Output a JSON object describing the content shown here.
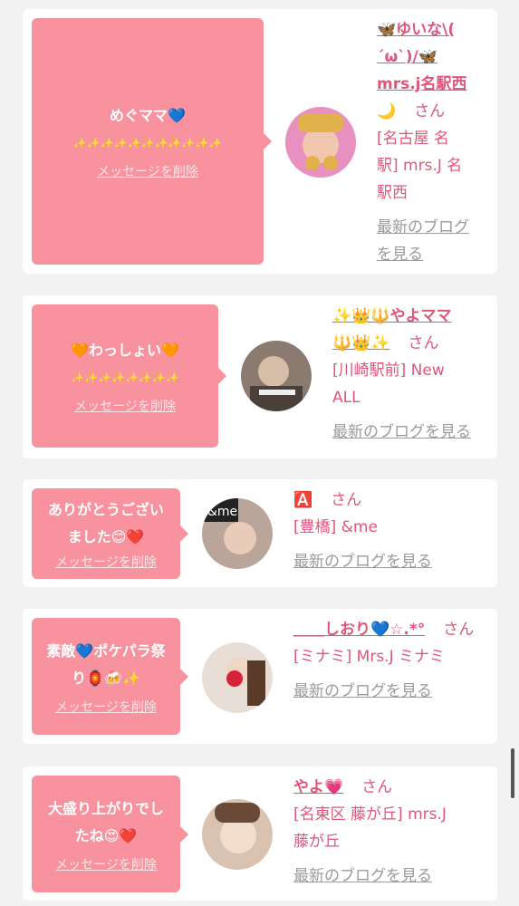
{
  "delete_label": "メッセージを削除",
  "blog_label": "最新のブログを見る",
  "san": "さん",
  "messages": [
    {
      "msg_lines": [
        "めぐママ💙",
        "✨✨✨✨✨✨✨✨✨✨✨"
      ],
      "name_lines": [
        "🦋ゆいな\\(",
        "´ω`)/🦋",
        "mrs.j名駅西"
      ],
      "name_tail": "🌙",
      "shop_lines": [
        "[名古屋 名",
        "駅] mrs.J 名",
        "駅西"
      ],
      "blog_lines": [
        "最新のブログ",
        "を見る"
      ]
    },
    {
      "msg_lines": [
        "🧡わっしょい🧡",
        "✨✨✨✨✨✨✨✨"
      ],
      "name_lines": [
        "✨👑🔱やよママ"
      ],
      "name_tail": "🔱👑✨",
      "shop_lines": [
        "[川崎駅前] New",
        "ALL"
      ],
      "blog_lines": [
        "最新のブログを見る"
      ]
    },
    {
      "msg_lines": [
        "ありがとうござい",
        "ました😊❤️"
      ],
      "name_lines": [],
      "name_tail": "🅰️",
      "shop_lines": [
        "[豊橋] &me"
      ],
      "blog_lines": [
        "最新のブログを見る"
      ]
    },
    {
      "msg_lines": [
        "素敵💙ポケパラ祭",
        "り🏮🍻✨"
      ],
      "name_lines": [
        "＿＿しおり💙☆.*°"
      ],
      "name_tail": "",
      "shop_lines": [
        "[ミナミ] Mrs.J ミナミ"
      ],
      "blog_lines": [
        "最新のブログを見る"
      ]
    },
    {
      "msg_lines": [
        "大盛り上がりでし",
        "たね😍❤️"
      ],
      "name_lines": [],
      "name_tail": "やよ💗",
      "shop_lines": [
        "[名東区 藤が丘] mrs.J",
        "藤が丘"
      ],
      "blog_lines": [
        "最新のブログを見る"
      ]
    }
  ]
}
